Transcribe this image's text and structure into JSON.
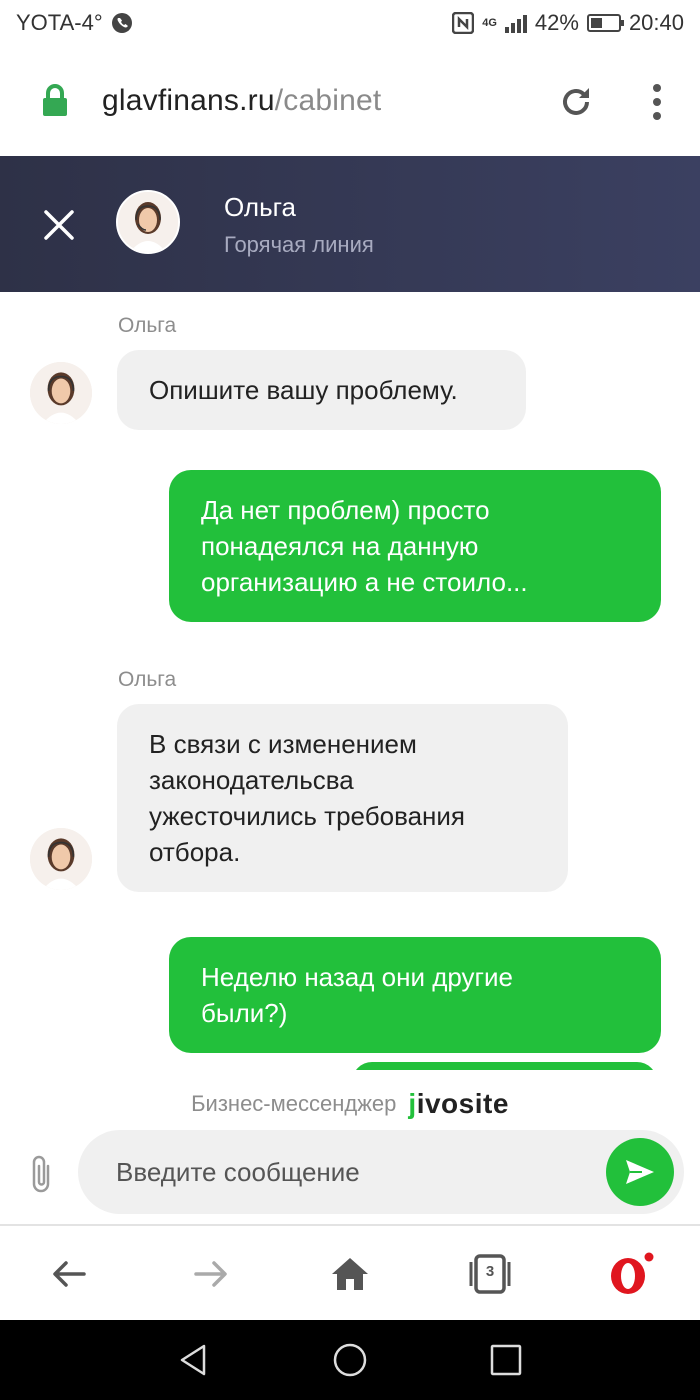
{
  "status_bar": {
    "carrier": "YOTA-4°",
    "network": "4G",
    "battery": "42%",
    "battery_level": 0.42,
    "time": "20:40"
  },
  "browser": {
    "url_domain": "glavfinans.ru",
    "url_path": "/cabinet",
    "tabs_count": "3"
  },
  "chat": {
    "agent_name": "Ольга",
    "agent_role": "Горячая линия",
    "messages": [
      {
        "from": "agent",
        "sender": "Ольга",
        "lines": [
          "Опишите вашу проблему."
        ]
      },
      {
        "from": "user",
        "lines": [
          "Да нет проблем) просто",
          "понадеялся на данную",
          "организацию а не стоило..."
        ]
      },
      {
        "from": "agent",
        "sender": "Ольга",
        "lines": [
          "В связи с изменением",
          "законодательсва",
          "ужесточились требования",
          "отбора."
        ]
      },
      {
        "from": "user",
        "lines": [
          "Неделю назад они другие",
          "были?)"
        ]
      }
    ],
    "powered_by": "Бизнес-мессенджер",
    "brand": "jivosite",
    "input_placeholder": "Введите сообщение"
  },
  "colors": {
    "header_bg": "#2e3147",
    "user_bubble": "#22c03b",
    "agent_bubble": "#f0f0f0",
    "lock_green": "#34a853",
    "opera_red": "#e0161f"
  }
}
